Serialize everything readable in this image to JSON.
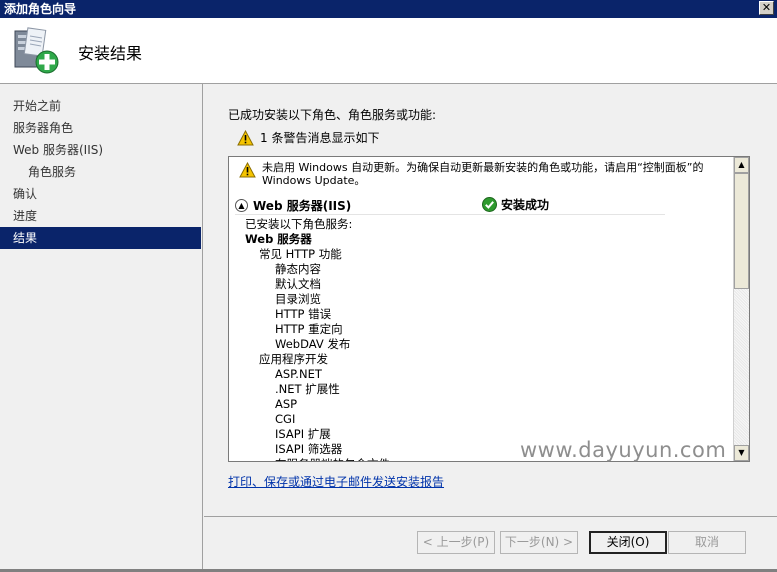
{
  "window": {
    "title": "添加角色向导",
    "close_glyph": "✕"
  },
  "header": {
    "title": "安装结果",
    "icon": "server-add-icon"
  },
  "nav": {
    "items": [
      {
        "label": "开始之前",
        "level": 0,
        "active": false
      },
      {
        "label": "服务器角色",
        "level": 0,
        "active": false
      },
      {
        "label": "Web 服务器(IIS)",
        "level": 0,
        "active": false
      },
      {
        "label": "角色服务",
        "level": 1,
        "active": false
      },
      {
        "label": "确认",
        "level": 0,
        "active": false
      },
      {
        "label": "进度",
        "level": 0,
        "active": false
      },
      {
        "label": "结果",
        "level": 0,
        "active": true
      }
    ]
  },
  "main": {
    "intro": "已成功安装以下角色、角色服务或功能:",
    "warning_summary": "1 条警告消息显示如下",
    "warning_message": "未启用 Windows 自动更新。为确保自动更新最新安装的角色或功能，请启用“控制面板”的 Windows Update。",
    "section": {
      "name": "Web 服务器(IIS)",
      "status": "安装成功"
    },
    "tree": [
      {
        "text": "已安装以下角色服务:",
        "cls": "l0"
      },
      {
        "text": "Web 服务器",
        "cls": "l0b"
      },
      {
        "text": "常见 HTTP 功能",
        "cls": "l1"
      },
      {
        "text": "静态内容",
        "cls": "l2"
      },
      {
        "text": "默认文档",
        "cls": "l2"
      },
      {
        "text": "目录浏览",
        "cls": "l2"
      },
      {
        "text": "HTTP 错误",
        "cls": "l2"
      },
      {
        "text": "HTTP 重定向",
        "cls": "l2"
      },
      {
        "text": "WebDAV 发布",
        "cls": "l2"
      },
      {
        "text": "应用程序开发",
        "cls": "l1"
      },
      {
        "text": "ASP.NET",
        "cls": "l2"
      },
      {
        "text": ".NET 扩展性",
        "cls": "l2"
      },
      {
        "text": "ASP",
        "cls": "l2"
      },
      {
        "text": "CGI",
        "cls": "l2"
      },
      {
        "text": "ISAPI 扩展",
        "cls": "l2"
      },
      {
        "text": "ISAPI 筛选器",
        "cls": "l2"
      },
      {
        "text": "在服务器端的包含文件",
        "cls": "l2"
      }
    ],
    "print_link": "打印、保存或通过电子邮件发送安装报告",
    "watermark": "www.dayuyun.com"
  },
  "buttons": {
    "prev": "< 上一步(P)",
    "next": "下一步(N) >",
    "close": "关闭(O)",
    "cancel": "取消"
  },
  "colors": {
    "titlebar": "#0a246a",
    "nav_active": "#0a246a",
    "link": "#0033aa",
    "warning": "#f5c400",
    "success": "#2e9a2e"
  }
}
